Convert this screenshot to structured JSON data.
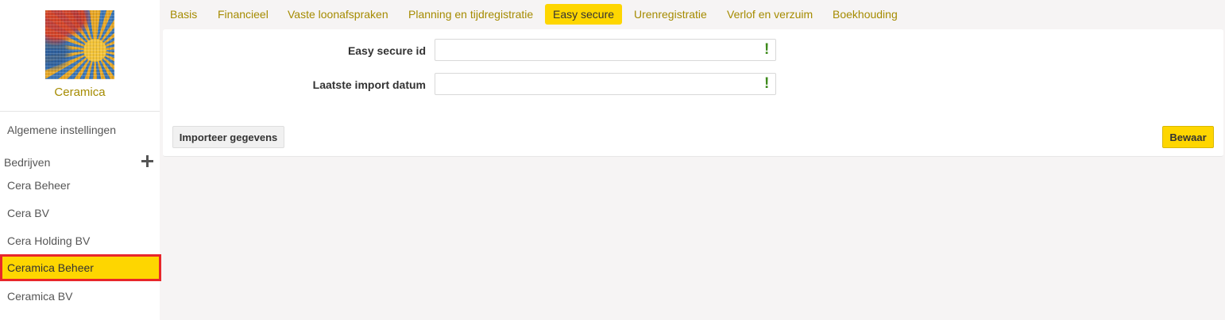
{
  "sidebar": {
    "brand_name": "Ceramica",
    "logo_icon": "mosaic-sun-logo",
    "general_settings": "Algemene instellingen",
    "companies_label": "Bedrijven",
    "add_icon": "plus-icon",
    "companies": [
      {
        "label": "Cera Beheer",
        "active": false
      },
      {
        "label": "Cera BV",
        "active": false
      },
      {
        "label": "Cera Holding BV",
        "active": false
      },
      {
        "label": "Ceramica Beheer",
        "active": true
      },
      {
        "label": "Ceramica BV",
        "active": false
      }
    ]
  },
  "tabs": [
    {
      "label": "Basis",
      "active": false
    },
    {
      "label": "Financieel",
      "active": false
    },
    {
      "label": "Vaste loonafspraken",
      "active": false
    },
    {
      "label": "Planning en tijdregistratie",
      "active": false
    },
    {
      "label": "Easy secure",
      "active": true
    },
    {
      "label": "Urenregistratie",
      "active": false
    },
    {
      "label": "Verlof en verzuim",
      "active": false
    },
    {
      "label": "Boekhouding",
      "active": false
    }
  ],
  "form": {
    "fields": [
      {
        "label": "Easy secure id",
        "value": "",
        "status_icon": "exclamation-icon",
        "status_mark": "!"
      },
      {
        "label": "Laatste import datum",
        "value": "",
        "status_icon": "exclamation-icon",
        "status_mark": "!"
      }
    ],
    "import_button": "Importeer gegevens",
    "save_button": "Bewaar"
  },
  "colors": {
    "accent": "#fed600",
    "link": "#a58b00",
    "active_border": "#e8262b",
    "warning": "#3e8a1c",
    "background": "#f6f4f4"
  }
}
